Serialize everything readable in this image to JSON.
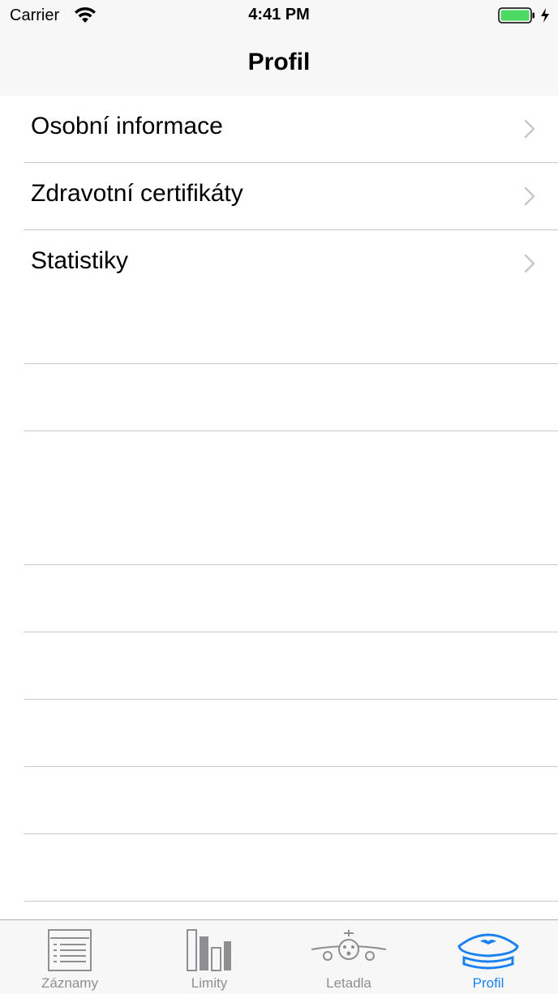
{
  "status_bar": {
    "carrier": "Carrier",
    "time": "4:41 PM",
    "battery_color": "#4cd964"
  },
  "nav": {
    "title": "Profil"
  },
  "menu_items": [
    {
      "label": "Osobní informace",
      "icon": "chevron-right-icon"
    },
    {
      "label": "Zdravotní certifikáty",
      "icon": "chevron-right-icon"
    },
    {
      "label": "Statistiky",
      "icon": "chevron-right-icon"
    }
  ],
  "tabs": [
    {
      "label": "Záznamy",
      "icon": "records-icon",
      "active": false
    },
    {
      "label": "Limity",
      "icon": "bar-chart-icon",
      "active": false
    },
    {
      "label": "Letadla",
      "icon": "airplane-icon",
      "active": false
    },
    {
      "label": "Profil",
      "icon": "pilot-cap-icon",
      "active": true
    }
  ],
  "colors": {
    "accent": "#1a82f0",
    "inactive": "#8e8e93",
    "separator": "#c8c7cc"
  }
}
